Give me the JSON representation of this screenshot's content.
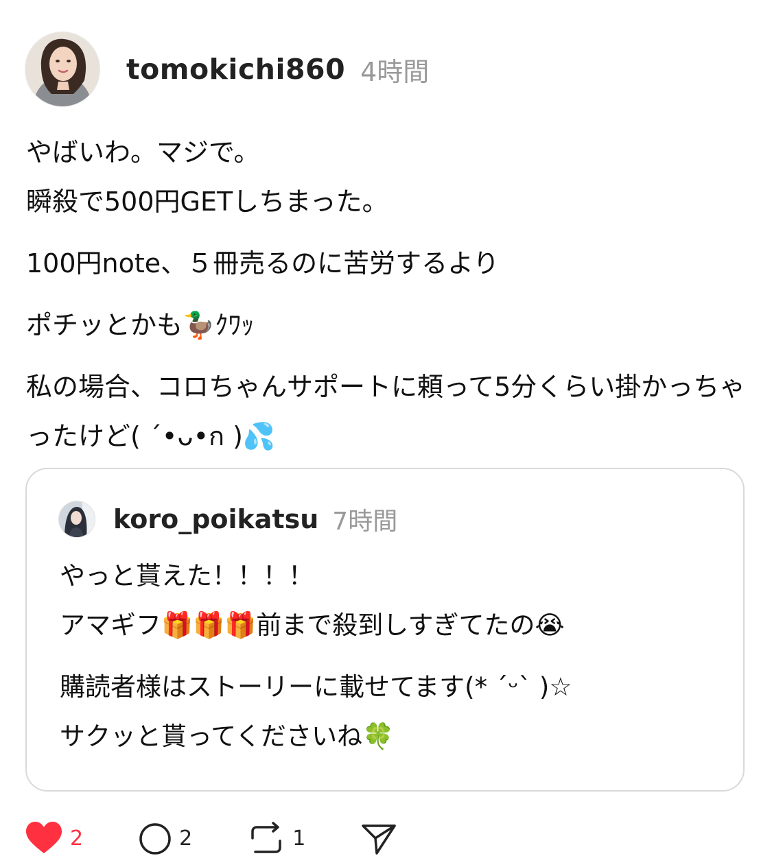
{
  "post": {
    "username": "tomokichi860",
    "timestamp": "4時間",
    "avatar_icon": "user-avatar-photo",
    "paragraphs": [
      "やばいわ。マジで。\n瞬殺で500円GETしちまった。",
      "100円note、５冊売るのに苦労するより",
      "ポチッとかも🦆ｸﾜｯ",
      "私の場合、コロちゃんサポートに頼って5分くらい掛かっちゃったけど( ˊ•ᴗ•ก )💦"
    ]
  },
  "quote": {
    "username": "koro_poikatsu",
    "timestamp": "7時間",
    "avatar_icon": "user-avatar-photo",
    "paragraphs": [
      "やっと貰えた！！！！\nアマギフ🎁🎁🎁前まで殺到しすぎてたの😭",
      "購読者様はストーリーに載せてます(* ˊᵕˋ )☆\nサクッと貰ってくださいね🍀"
    ]
  },
  "actions": {
    "like_icon": "heart-icon",
    "like_count": "2",
    "comment_icon": "comment-icon",
    "comment_count": "2",
    "repost_icon": "repost-icon",
    "repost_count": "1",
    "share_icon": "send-icon",
    "like_color": "#ff3040"
  }
}
